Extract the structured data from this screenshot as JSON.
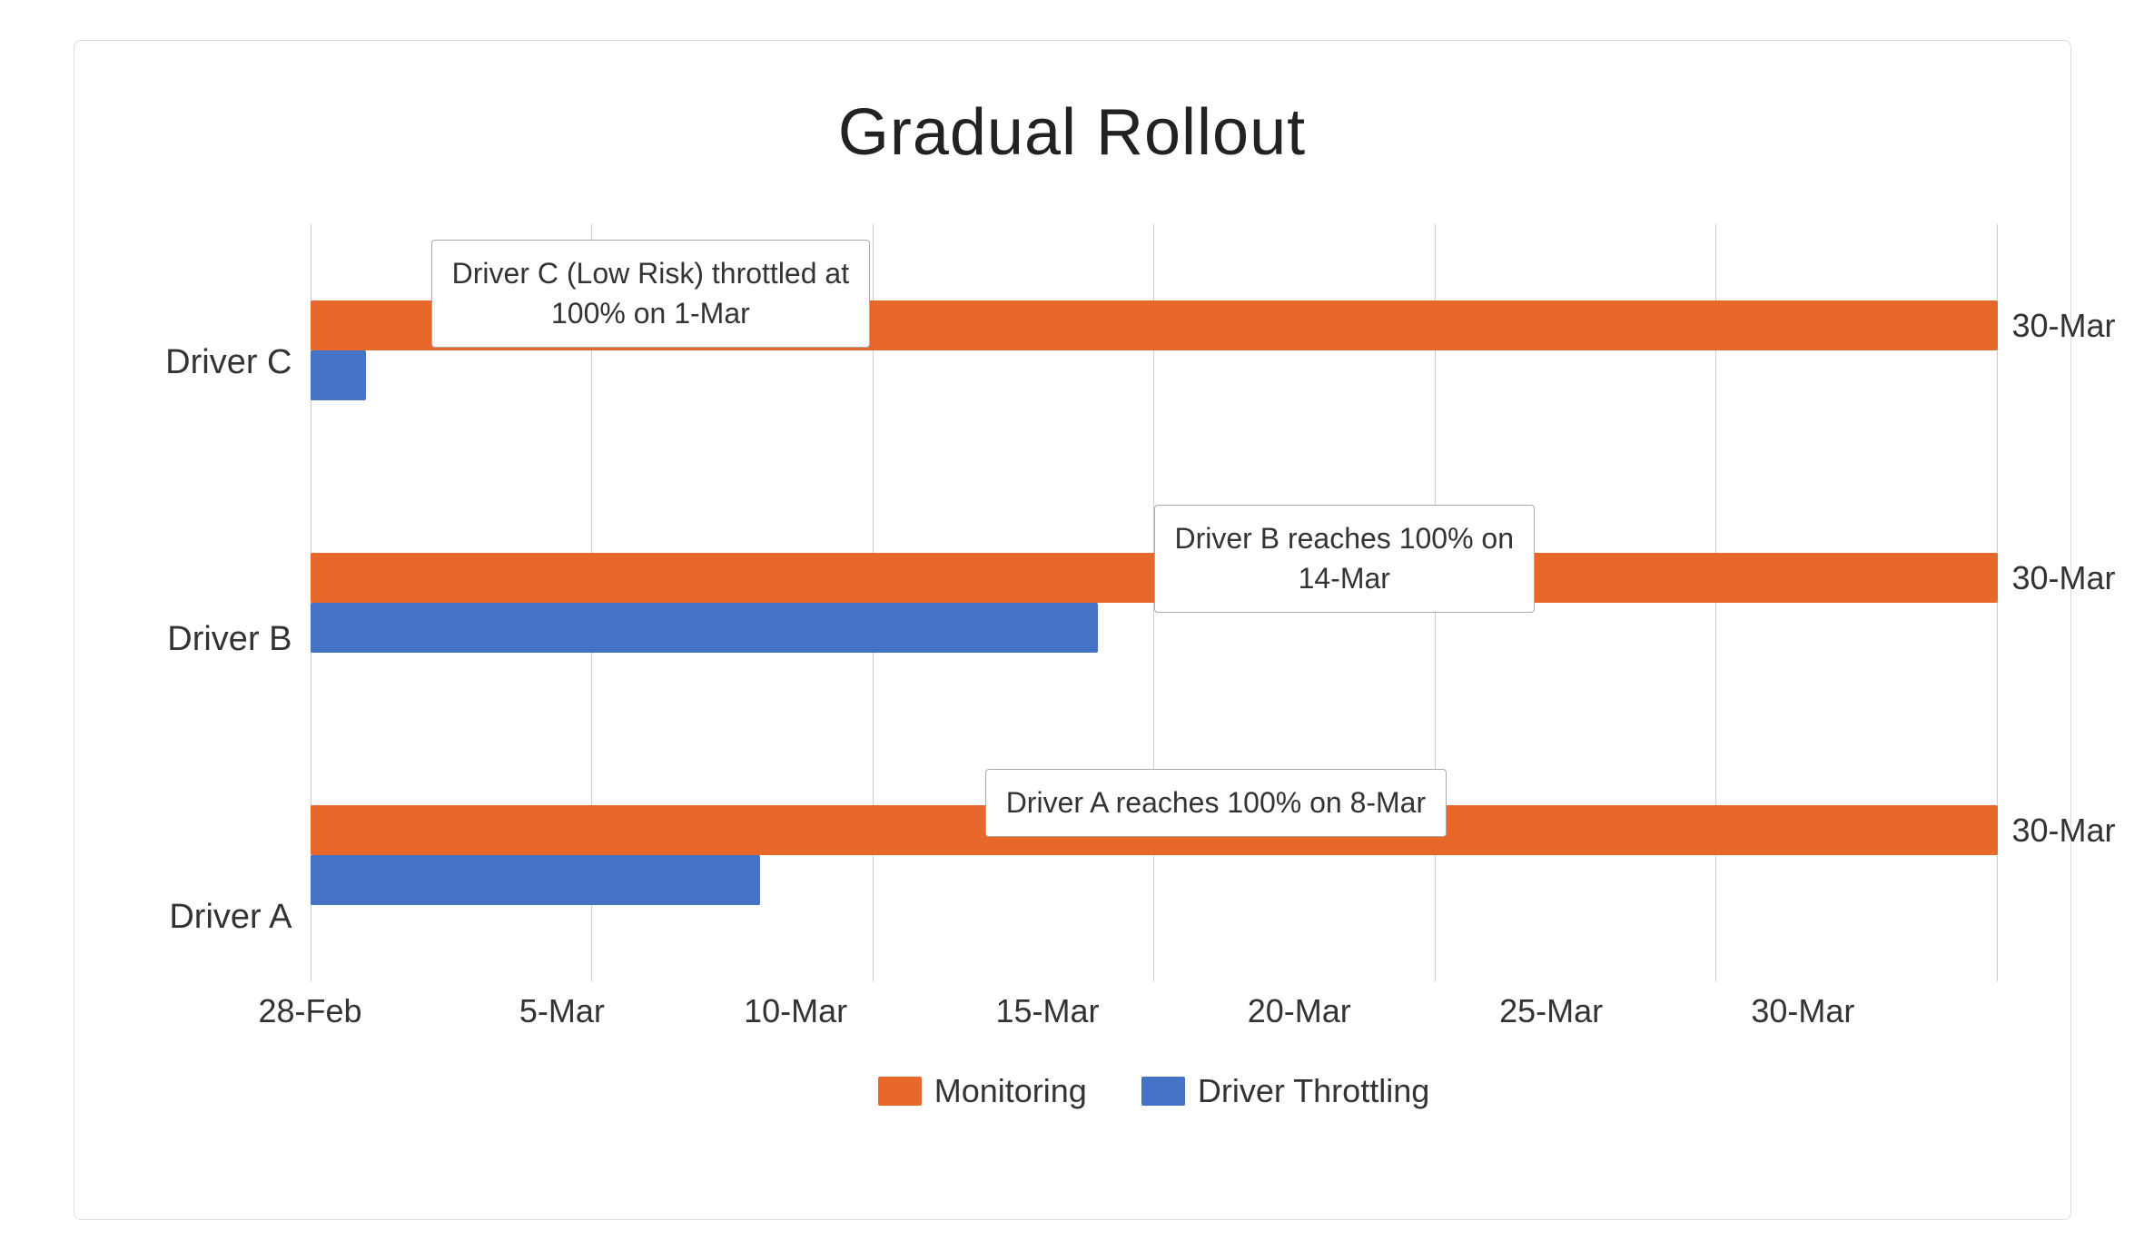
{
  "title": "Gradual Rollout",
  "chart": {
    "drivers": [
      {
        "label": "Driver C",
        "right_label": "30-Mar"
      },
      {
        "label": "Driver B",
        "right_label": "30-Mar"
      },
      {
        "label": "Driver A",
        "right_label": "30-Mar"
      }
    ],
    "x_axis": {
      "ticks": [
        "28-Feb",
        "5-Mar",
        "10-Mar",
        "15-Mar",
        "20-Mar",
        "25-Mar",
        "30-Mar"
      ]
    },
    "bars": {
      "total_days": 31,
      "start_offset": 0,
      "driver_c": {
        "orange_start": 0,
        "orange_end": 31,
        "blue_start": 0,
        "blue_end": 1
      },
      "driver_b": {
        "orange_start": 0,
        "orange_end": 31,
        "blue_start": 0,
        "blue_end": 14
      },
      "driver_a": {
        "orange_start": 0,
        "orange_end": 31,
        "blue_start": 0,
        "blue_end": 8
      }
    },
    "callouts": [
      {
        "id": "callout-c",
        "text": "Driver C (Low Risk) throttled at\n100% on 1-Mar"
      },
      {
        "id": "callout-b",
        "text": "Driver B reaches 100% on\n14-Mar"
      },
      {
        "id": "callout-a",
        "text": "Driver A reaches 100% on 8-Mar"
      }
    ]
  },
  "legend": {
    "items": [
      {
        "label": "Monitoring",
        "color": "orange"
      },
      {
        "label": "Driver Throttling",
        "color": "blue"
      }
    ]
  }
}
